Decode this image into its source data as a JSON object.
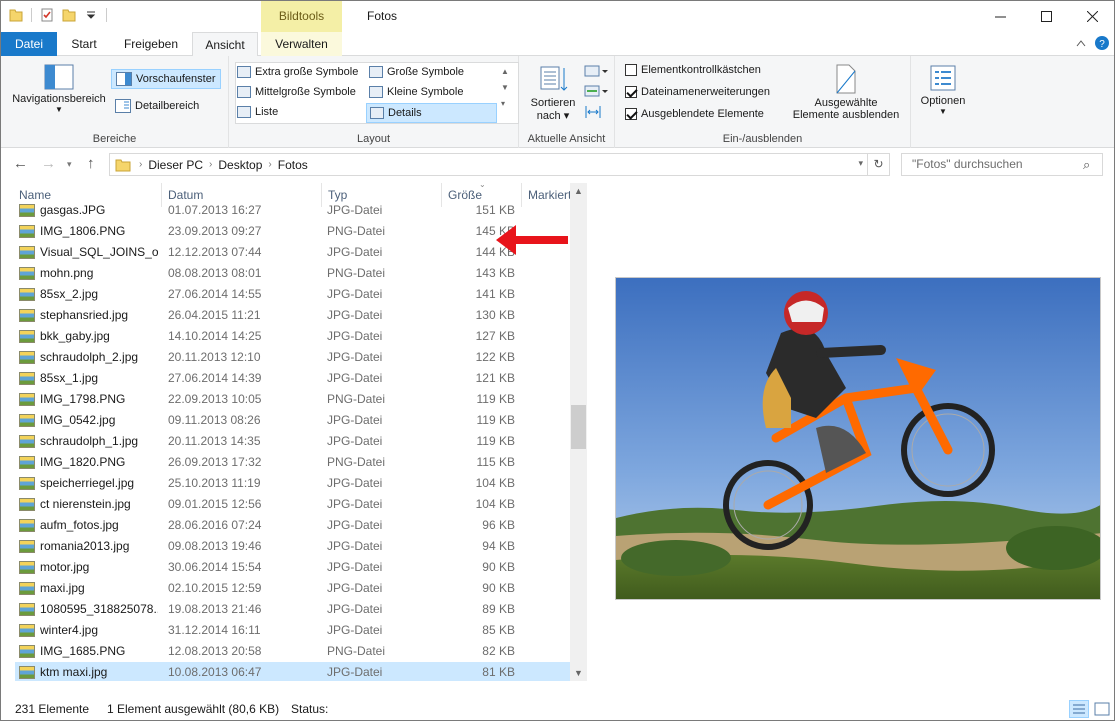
{
  "window": {
    "context_tab": "Bildtools",
    "title": "Fotos"
  },
  "ribbon_tabs": {
    "file": "Datei",
    "start": "Start",
    "share": "Freigeben",
    "view": "Ansicht",
    "manage": "Verwalten"
  },
  "ribbon": {
    "panes": {
      "navigation_pane": "Navigationsbereich",
      "preview_pane": "Vorschaufenster",
      "details_pane": "Detailbereich",
      "group_label": "Bereiche"
    },
    "layout": {
      "extra_large": "Extra große Symbole",
      "large": "Große Symbole",
      "medium": "Mittelgroße Symbole",
      "small": "Kleine Symbole",
      "list": "Liste",
      "details": "Details",
      "group_label": "Layout"
    },
    "current_view": {
      "sort_line1": "Sortieren",
      "sort_line2": "nach",
      "group_label": "Aktuelle Ansicht"
    },
    "show_hide": {
      "item_checkboxes": "Elementkontrollkästchen",
      "file_extensions": "Dateinamenerweiterungen",
      "hidden_items": "Ausgeblendete Elemente",
      "hide_selected_line1": "Ausgewählte",
      "hide_selected_line2": "Elemente ausblenden",
      "group_label": "Ein-/ausblenden",
      "item_checkboxes_checked": false,
      "file_extensions_checked": true,
      "hidden_items_checked": true
    },
    "options": "Optionen"
  },
  "address": {
    "crumbs": [
      "Dieser PC",
      "Desktop",
      "Fotos"
    ],
    "search_placeholder": "\"Fotos\" durchsuchen"
  },
  "columns": {
    "name": "Name",
    "date": "Datum",
    "type": "Typ",
    "size": "Größe",
    "tags": "Markiert"
  },
  "files": [
    {
      "name": "gasgas.JPG",
      "date": "01.07.2013 16:27",
      "type": "JPG-Datei",
      "size": "151 KB"
    },
    {
      "name": "IMG_1806.PNG",
      "date": "23.09.2013 09:27",
      "type": "PNG-Datei",
      "size": "145 KB"
    },
    {
      "name": "Visual_SQL_JOINS_o...",
      "date": "12.12.2013 07:44",
      "type": "JPG-Datei",
      "size": "144 KB"
    },
    {
      "name": "mohn.png",
      "date": "08.08.2013 08:01",
      "type": "PNG-Datei",
      "size": "143 KB"
    },
    {
      "name": "85sx_2.jpg",
      "date": "27.06.2014 14:55",
      "type": "JPG-Datei",
      "size": "141 KB"
    },
    {
      "name": "stephansried.jpg",
      "date": "26.04.2015 11:21",
      "type": "JPG-Datei",
      "size": "130 KB"
    },
    {
      "name": "bkk_gaby.jpg",
      "date": "14.10.2014 14:25",
      "type": "JPG-Datei",
      "size": "127 KB"
    },
    {
      "name": "schraudolph_2.jpg",
      "date": "20.11.2013 12:10",
      "type": "JPG-Datei",
      "size": "122 KB"
    },
    {
      "name": "85sx_1.jpg",
      "date": "27.06.2014 14:39",
      "type": "JPG-Datei",
      "size": "121 KB"
    },
    {
      "name": "IMG_1798.PNG",
      "date": "22.09.2013 10:05",
      "type": "PNG-Datei",
      "size": "119 KB"
    },
    {
      "name": "IMG_0542.jpg",
      "date": "09.11.2013 08:26",
      "type": "JPG-Datei",
      "size": "119 KB"
    },
    {
      "name": "schraudolph_1.jpg",
      "date": "20.11.2013 14:35",
      "type": "JPG-Datei",
      "size": "119 KB"
    },
    {
      "name": "IMG_1820.PNG",
      "date": "26.09.2013 17:32",
      "type": "PNG-Datei",
      "size": "115 KB"
    },
    {
      "name": "speicherriegel.jpg",
      "date": "25.10.2013 11:19",
      "type": "JPG-Datei",
      "size": "104 KB"
    },
    {
      "name": "ct nierenstein.jpg",
      "date": "09.01.2015 12:56",
      "type": "JPG-Datei",
      "size": "104 KB"
    },
    {
      "name": "aufm_fotos.jpg",
      "date": "28.06.2016 07:24",
      "type": "JPG-Datei",
      "size": "96 KB"
    },
    {
      "name": "romania2013.jpg",
      "date": "09.08.2013 19:46",
      "type": "JPG-Datei",
      "size": "94 KB"
    },
    {
      "name": "motor.jpg",
      "date": "30.06.2014 15:54",
      "type": "JPG-Datei",
      "size": "90 KB"
    },
    {
      "name": "maxi.jpg",
      "date": "02.10.2015 12:59",
      "type": "JPG-Datei",
      "size": "90 KB"
    },
    {
      "name": "1080595_318825078...",
      "date": "19.08.2013 21:46",
      "type": "JPG-Datei",
      "size": "89 KB"
    },
    {
      "name": "winter4.jpg",
      "date": "31.12.2014 16:11",
      "type": "JPG-Datei",
      "size": "85 KB"
    },
    {
      "name": "IMG_1685.PNG",
      "date": "12.08.2013 20:58",
      "type": "PNG-Datei",
      "size": "82 KB"
    },
    {
      "name": "ktm maxi.jpg",
      "date": "10.08.2013 06:47",
      "type": "JPG-Datei",
      "size": "81 KB",
      "selected": true
    }
  ],
  "status": {
    "count": "231 Elemente",
    "selection": "1 Element ausgewählt (80,6 KB)",
    "state": "Status:"
  },
  "colors": {
    "accent": "#1979ca",
    "selection": "#cce8ff",
    "context_tab": "#f4efa6",
    "arrow": "#e8141b"
  }
}
